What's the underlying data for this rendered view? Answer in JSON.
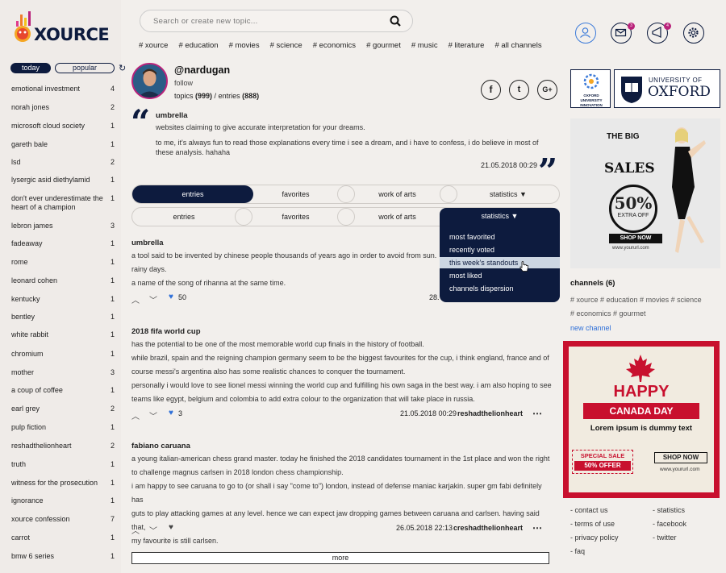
{
  "brand": {
    "name": "XOURCE"
  },
  "sidebar": {
    "tabs": [
      {
        "label": "today"
      },
      {
        "label": "popular"
      }
    ],
    "trending": [
      {
        "label": "emotional investment",
        "count": "4"
      },
      {
        "label": "norah jones",
        "count": "2"
      },
      {
        "label": "microsoft cloud society",
        "count": "1"
      },
      {
        "label": "gareth bale",
        "count": "1"
      },
      {
        "label": "lsd",
        "count": "2"
      },
      {
        "label": "lysergic asid diethylamid",
        "count": "1"
      },
      {
        "label": "don't ever underestimate the heart of a champion",
        "count": "1"
      },
      {
        "label": "lebron james",
        "count": "3"
      },
      {
        "label": "fadeaway",
        "count": "1"
      },
      {
        "label": "rome",
        "count": "1"
      },
      {
        "label": "leonard cohen",
        "count": "1"
      },
      {
        "label": "kentucky",
        "count": "1"
      },
      {
        "label": "bentley",
        "count": "1"
      },
      {
        "label": "white rabbit",
        "count": "1"
      },
      {
        "label": "chromium",
        "count": "1"
      },
      {
        "label": "mother",
        "count": "3"
      },
      {
        "label": "a coup of coffee",
        "count": "1"
      },
      {
        "label": "earl grey",
        "count": "2"
      },
      {
        "label": "pulp fiction",
        "count": "1"
      },
      {
        "label": "reshadthelionheart",
        "count": "2"
      },
      {
        "label": "truth",
        "count": "1"
      },
      {
        "label": "witness for the prosecution",
        "count": "1"
      },
      {
        "label": "ignorance",
        "count": "1"
      },
      {
        "label": "xource confession",
        "count": "7"
      },
      {
        "label": "carrot",
        "count": "1"
      },
      {
        "label": "bmw 6 series",
        "count": "1"
      }
    ]
  },
  "search": {
    "placeholder": "Search or create new topic..."
  },
  "hashtags": [
    "# xource",
    "# education",
    "# movies",
    "# science",
    "# economics",
    "# gourmet",
    "# music",
    "# literature",
    "# all channels"
  ],
  "notifications": {
    "messages": "3",
    "announcements": "4"
  },
  "profile": {
    "username": "@nardugan",
    "follow": "follow",
    "topics_label": "topics",
    "topics": "(999)",
    "sep": " / ",
    "entries_label": "entries",
    "entries": "(888)",
    "social": [
      "f",
      "t",
      "G+"
    ]
  },
  "quote": {
    "title": "umbrella",
    "line1": "websites claiming to give accurate interpretation for your dreams.",
    "line2": "to me, it's always fun to read those explanations every time i see a dream, and i have to confess, i do believe in most of these analysis. hahaha",
    "date": "21.05.2018 00:29"
  },
  "tabbar1": {
    "tabs": [
      "entries",
      "favorites",
      "work of arts",
      "statistics"
    ]
  },
  "tabbar2": {
    "tabs": [
      "entries",
      "favorites",
      "work of arts",
      "statistics"
    ]
  },
  "dropdown": {
    "items": [
      "most favorited",
      "recently voted",
      "this week's standouts",
      "most liked",
      "channels dispersion"
    ]
  },
  "entries": [
    {
      "title": "umbrella",
      "lines": [
        "a tool said to be invented by chinese people thousands of years ago in order to avoid from sun.",
        "rainy days.",
        "a name of the song of rihanna at the same time."
      ],
      "likes": "50",
      "date": "28.",
      "author": ""
    },
    {
      "title": "2018 fifa world cup",
      "lines": [
        "has the potential to be one of the most memorable world cup finals in the history of football.",
        "while brazil, spain and the reigning champion germany seem to be the biggest favourites for the cup, i think england, france and of",
        "course messi's argentina also has some realistic chances to conquer the tournament.",
        "personally i would love to see lionel messi winning the world cup and fulfilling his own saga in the best way. i am also hoping to see",
        "teams like egypt, belgium and colombia to add extra colour to the organization that will take place in russia."
      ],
      "likes": "3",
      "date": "21.05.2018 00:29",
      "author": "reshadthelionheart"
    },
    {
      "title": "fabiano caruana",
      "lines": [
        "a young italian-american chess grand master. today he finished the 2018 candidates tournament in the 1st place and won the right",
        "to challenge magnus carlsen in 2018 london chess championship.",
        "i am happy to see caruana to go to (or shall i say \"come to\") london, instead of defense maniac karjakin. super gm fabi definitely has",
        "guts to play attacking games at any level. hence we can expect jaw dropping games between caruana and carlsen. having said that,",
        "my favourite is still carlsen."
      ],
      "likes": "",
      "date": "26.05.2018 22:13",
      "author": "creshadthelionheart"
    }
  ],
  "more_label": "more",
  "ads": {
    "oxford_innovation": "OXFORD UNIVERSITY INNOVATION",
    "oxford_univ_of": "UNIVERSITY OF",
    "oxford_name": "OXFORD",
    "sale_the_big": "THE BIG",
    "sale_sales": "SALES",
    "sale_pct": "50%",
    "sale_extra": "EXTRA OFF",
    "sale_shop": "SHOP NOW",
    "sale_url": "www.yoururl.com",
    "canada_happy": "HAPPY",
    "canada_day": "CANADA DAY",
    "canada_lorem": "Lorem ipsum is dummy text",
    "canada_special": "SPECIAL SALE",
    "canada_offer": "50% OFFER",
    "canada_shop": "SHOP NOW",
    "canada_url": "www.yoururl.com"
  },
  "channels": {
    "title": "channels",
    "count": "(6)",
    "tags_row1": "# xource  # education  # movies  # science",
    "tags_row2": "# economics  # gourmet",
    "new_channel": "new channel"
  },
  "footer": {
    "col1": [
      "- contact us",
      "- terms of use",
      "- privacy policy",
      "- faq"
    ],
    "col2": [
      "- statistics",
      "- facebook",
      "- twitter"
    ]
  },
  "colors": {
    "navy": "#0d1b3e",
    "accent": "#b9227a",
    "red": "#c8102e",
    "like_blue": "#2e6fd8"
  }
}
